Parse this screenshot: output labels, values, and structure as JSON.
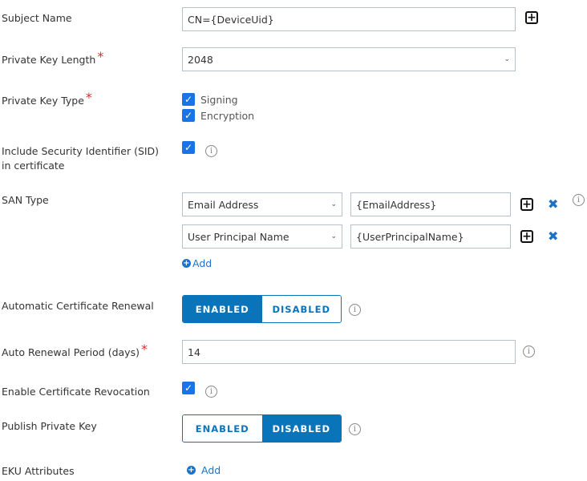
{
  "subject_name": {
    "label": "Subject Name",
    "value": "CN={DeviceUid}"
  },
  "key_length": {
    "label": "Private Key Length",
    "value": "2048"
  },
  "key_type": {
    "label": "Private Key Type",
    "options": [
      {
        "label": "Signing",
        "checked": true
      },
      {
        "label": "Encryption",
        "checked": true
      }
    ]
  },
  "sid": {
    "label": "Include Security Identifier (SID) in certificate",
    "checked": true
  },
  "san": {
    "label": "SAN Type",
    "rows": [
      {
        "type": "Email Address",
        "value": "{EmailAddress}"
      },
      {
        "type": "User Principal Name",
        "value": "{UserPrincipalName}"
      }
    ],
    "add_label": "Add"
  },
  "auto_renewal": {
    "label": "Automatic Certificate Renewal",
    "enabled_label": "ENABLED",
    "disabled_label": "DISABLED",
    "selected": "ENABLED"
  },
  "renewal_period": {
    "label": "Auto Renewal Period (days)",
    "value": "14"
  },
  "revocation": {
    "label": "Enable Certificate Revocation",
    "checked": true
  },
  "publish_key": {
    "label": "Publish Private Key",
    "enabled_label": "ENABLED",
    "disabled_label": "DISABLED",
    "selected": "DISABLED"
  },
  "eku": {
    "label": "EKU Attributes",
    "add_label": "Add"
  },
  "colors": {
    "accent": "#0a74bb",
    "checkbox": "#1a73e8",
    "required": "#d0312d"
  }
}
